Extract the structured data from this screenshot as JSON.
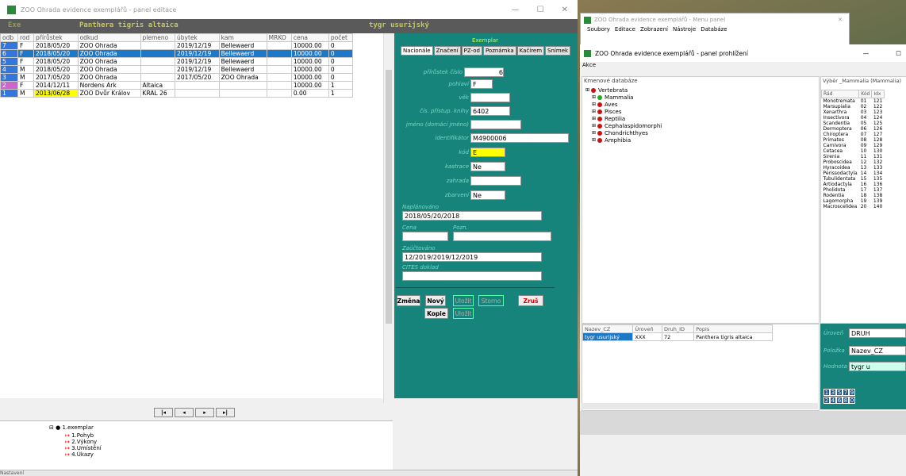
{
  "left_window": {
    "title": "ZOO Ohrada evidence exemplářů - panel editace",
    "header": {
      "left": "Exe",
      "center": "Panthera tigris altaica",
      "right": "tygr usurijský"
    },
    "grid": {
      "headers": [
        "odb",
        "rod",
        "přírůstek",
        "odkud",
        "plemeno",
        "úbytek",
        "kam",
        "MRKO",
        "cena",
        "počet"
      ],
      "rows": [
        {
          "id": "7",
          "sex": "F",
          "date": "2018/05/20",
          "from": "ZOO Ohrada",
          "breed": "",
          "out": "2019/12/19",
          "to": "Bellewaerd",
          "mrko": "",
          "price": "10000.00",
          "count": "0"
        },
        {
          "id": "6",
          "sex": "F",
          "date": "2018/05/20",
          "from": "ZOO Ohrada",
          "breed": "",
          "out": "2019/12/19",
          "to": "Bellewaerd",
          "mrko": "",
          "price": "10000.00",
          "count": "0"
        },
        {
          "id": "5",
          "sex": "F",
          "date": "2018/05/20",
          "from": "ZOO Ohrada",
          "breed": "",
          "out": "2019/12/19",
          "to": "Bellewaerd",
          "mrko": "",
          "price": "10000.00",
          "count": "0"
        },
        {
          "id": "4",
          "sex": "M",
          "date": "2018/05/20",
          "from": "ZOO Ohrada",
          "breed": "",
          "out": "2019/12/19",
          "to": "Bellewaerd",
          "mrko": "",
          "price": "10000.00",
          "count": "0"
        },
        {
          "id": "3",
          "sex": "M",
          "date": "2017/05/20",
          "from": "ZOO Ohrada",
          "breed": "",
          "out": "2017/05/20",
          "to": "ZOO Ohrada",
          "mrko": "",
          "price": "10000.00",
          "count": "0"
        },
        {
          "id": "2",
          "sex": "F",
          "date": "2014/12/11",
          "from": "Nordens Ark",
          "breed": "Altaica",
          "out": "",
          "to": "",
          "mrko": "",
          "price": "10000.00",
          "count": "1"
        },
        {
          "id": "1",
          "sex": "M",
          "date": "2013/06/28",
          "from": "ZOO Dvůr Králov",
          "breed": "KRAL 26",
          "out": "",
          "to": "",
          "mrko": "",
          "price": "0.00",
          "count": "1"
        }
      ]
    },
    "nav": [
      "|◂",
      "◂",
      "▸",
      "▸|"
    ],
    "tree": {
      "root": "1.exemplar",
      "children": [
        "1.Pohyb",
        "2.Výkony",
        "3.Umístění",
        "4.Úkazy"
      ]
    },
    "status": "Nastavení"
  },
  "detail_panel": {
    "title": "Exemplar",
    "tabs": [
      "Nacionále",
      "Značení",
      "PZ-od",
      "Poznámka",
      "Kačírem",
      "Snímek"
    ],
    "fields": [
      {
        "label": "přírůstek číslo",
        "value": "6"
      },
      {
        "label": "pohlaví",
        "value": "F"
      },
      {
        "label": "věk",
        "value": ""
      },
      {
        "label": "čís. přístup. knihy",
        "value": "6402"
      },
      {
        "label": "jméno (domácí jméno)",
        "value": ""
      },
      {
        "label": "identifikátor",
        "value": "M4900006"
      },
      {
        "label": "kód",
        "value": "E"
      },
      {
        "label": "kastrace",
        "value": "Ne"
      },
      {
        "label": "zahrada",
        "value": ""
      },
      {
        "label": "zbarvení",
        "value": "Ne"
      }
    ],
    "lower": [
      {
        "label": "Naplánováno",
        "value": "2018/05/20/2018"
      },
      {
        "label": "Cena",
        "value": ""
      },
      {
        "label": "Pozn.",
        "value": ""
      },
      {
        "label": "Zaúčtováno",
        "value": "12/2019/2019/12/2019"
      },
      {
        "label": "CITES doklad",
        "value": ""
      }
    ],
    "buttons": {
      "change": "Změna",
      "new": "Nový",
      "delete": "Uložit",
      "cancel": "Storno",
      "exit": "Zruš",
      "copy": "Kopie",
      "print": "Uložit"
    }
  },
  "right_window": {
    "bg_title": "ZOO Ohrada evidence exemplářů - Menu panel",
    "bg_menu": [
      "Soubory",
      "Editace",
      "Zobrazení",
      "Nástroje",
      "Databáze"
    ],
    "title": "ZOO Ohrada evidence exemplářů - panel prohlížení",
    "menu": "Akce",
    "tree_header": "Kmenové databáze",
    "tree_items": [
      {
        "name": "Vertebrata",
        "color": "#cc1111"
      },
      {
        "name": "Mammalia",
        "color": "#22aa22"
      },
      {
        "name": "Aves",
        "color": "#cc1111"
      },
      {
        "name": "Pisces",
        "color": "#cc1111"
      },
      {
        "name": "Reptilia",
        "color": "#cc1111"
      },
      {
        "name": "Cephalaspidomorphi",
        "color": "#cc1111"
      },
      {
        "name": "Chondrichthyes",
        "color": "#cc1111"
      },
      {
        "name": "Amphibia",
        "color": "#cc1111"
      }
    ],
    "side_header": "Výběr _Mammalia (Mammalia)",
    "side_cols": [
      "Řád",
      "Kód",
      "Idx"
    ],
    "side_rows": [
      [
        "Monotremata",
        "01",
        "121"
      ],
      [
        "Marsupialia",
        "02",
        "122"
      ],
      [
        "Xenarthra",
        "03",
        "123"
      ],
      [
        "Insectivora",
        "04",
        "124"
      ],
      [
        "Scandentia",
        "05",
        "125"
      ],
      [
        "Dermoptera",
        "06",
        "126"
      ],
      [
        "Chiroptera",
        "07",
        "127"
      ],
      [
        "Primates",
        "08",
        "128"
      ],
      [
        "Carnivora",
        "09",
        "129"
      ],
      [
        "Cetacea",
        "10",
        "130"
      ],
      [
        "Sirenia",
        "11",
        "131"
      ],
      [
        "Proboscidea",
        "12",
        "132"
      ],
      [
        "Hyracoidea",
        "13",
        "133"
      ],
      [
        "Perissodactyla",
        "14",
        "134"
      ],
      [
        "Tubulidentata",
        "15",
        "135"
      ],
      [
        "Artiodactyla",
        "16",
        "136"
      ],
      [
        "Pholidota",
        "17",
        "137"
      ],
      [
        "Rodentia",
        "18",
        "138"
      ],
      [
        "Lagomorpha",
        "19",
        "139"
      ],
      [
        "Macroscelidea",
        "20",
        "140"
      ]
    ],
    "bottom_cols": [
      "Nazev_CZ",
      "Úroveň",
      "Druh_ID",
      "Popis"
    ],
    "bottom_row": [
      "tygr usurijský",
      "XXX",
      "72",
      "Panthera tigris altaica"
    ],
    "filter": {
      "level_label": "Úroveň",
      "level_value": "DRUH",
      "name_label": "Položka",
      "name_value": "Nazev_CZ",
      "value_label": "Hodnota",
      "value_value": "tygr u"
    },
    "num_buttons_top": [
      "1",
      "3",
      "5",
      "7",
      "9"
    ],
    "num_buttons_bottom": [
      "2",
      "4",
      "6",
      "8",
      "0"
    ]
  },
  "colors": {
    "teal": "#16847b",
    "selection": "#1e78c8",
    "highlight": "#ffff00"
  }
}
